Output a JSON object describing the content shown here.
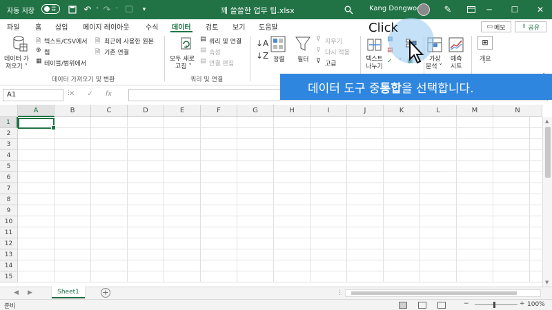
{
  "titlebar": {
    "autosave_label": "자동 저장",
    "toggle_state": "끔",
    "doc_title": "꽤 쓸쓸한 업무 팁.xlsx",
    "user_name": "Kang Dongwoo",
    "minimize": "─",
    "maximize": "☐",
    "close": "✕"
  },
  "tabs": [
    "파일",
    "홈",
    "삽입",
    "페이지 레이아웃",
    "수식",
    "데이터",
    "검토",
    "보기",
    "도움말"
  ],
  "active_tab": "데이터",
  "memo_label": "메모",
  "share_label": "공유",
  "ribbon": {
    "get_data": {
      "main_label_1": "데이터 가",
      "main_label_2": "져오기 ˅",
      "text_csv": "텍스트/CSV에서",
      "web": "웹",
      "table_range": "테이블/범위에서",
      "recent_sources": "최근에 사용한 원본",
      "existing_connections": "기존 연결",
      "group_label": "데이터 가져오기 및 변환"
    },
    "queries": {
      "refresh_1": "모두 새로",
      "refresh_2": "고침 ˅",
      "queries_connections": "쿼리 및 연결",
      "properties": "속성",
      "edit_links": "연결 편집",
      "group_label": "쿼리 및 연결"
    },
    "sort_filter": {
      "sort": "정렬",
      "filter": "필터",
      "clear": "지우기",
      "reapply": "다시 적용",
      "advanced": "고급"
    },
    "data_tools": {
      "text_to_columns_1": "텍스트",
      "text_to_columns_2": "나누기"
    },
    "forecast": {
      "whatif_1": "가상",
      "whatif_2": "분석 ˅",
      "forecast_sheet_1": "예측",
      "forecast_sheet_2": "시트"
    },
    "outline": {
      "label": "개요"
    }
  },
  "formula_bar": {
    "name_box": "A1",
    "cancel": "✕",
    "enter": "✓",
    "fx": "fx",
    "value": ""
  },
  "callout": {
    "click_text": "Click",
    "banner_before": "데이터 도구 중 ",
    "banner_bold": "통합",
    "banner_after": "을 선택합니다."
  },
  "grid": {
    "columns": [
      "A",
      "B",
      "C",
      "D",
      "E",
      "F",
      "G",
      "H",
      "I",
      "J",
      "K",
      "L",
      "M",
      "N"
    ],
    "rows": [
      "1",
      "2",
      "3",
      "4",
      "5",
      "6",
      "7",
      "8",
      "9",
      "10",
      "11",
      "12",
      "13",
      "14",
      "15"
    ],
    "selected_cell": "A1"
  },
  "sheets": [
    "Sheet1"
  ],
  "status": {
    "ready": "준비",
    "zoom": "100%",
    "zoom_minus": "−",
    "zoom_plus": "+"
  },
  "colors": {
    "accent": "#217346",
    "banner": "#2e86de"
  }
}
